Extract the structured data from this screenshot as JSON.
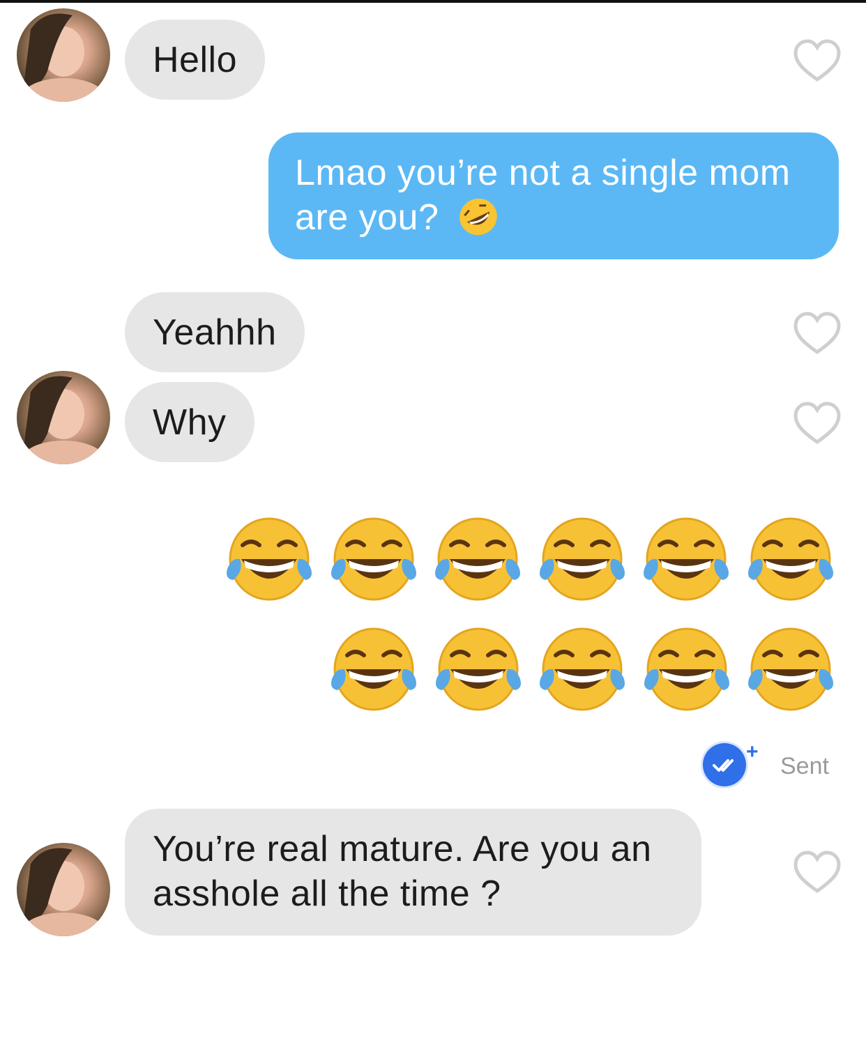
{
  "messages": [
    {
      "from": "them",
      "text": "Hello"
    },
    {
      "from": "me",
      "text_line1": "Lmao you’re not a single mom",
      "text_line2": "are you?",
      "emoji": "rolling-on-floor-laughing-emoji"
    },
    {
      "from": "them",
      "text": "Yeahhh"
    },
    {
      "from": "them",
      "text": "Why"
    },
    {
      "from": "me",
      "emoji_message": "face-with-tears-of-joy-emoji",
      "emoji_count": 11
    },
    {
      "from": "them",
      "text_line1": "You’re real mature. Are you an",
      "text_line2": "asshole all the time ?"
    }
  ],
  "status": {
    "label": "Sent",
    "plus": "+"
  },
  "colors": {
    "outgoing_bubble": "#5bb8f5",
    "incoming_bubble": "#e6e6e6",
    "check_badge": "#2f6fe8"
  }
}
